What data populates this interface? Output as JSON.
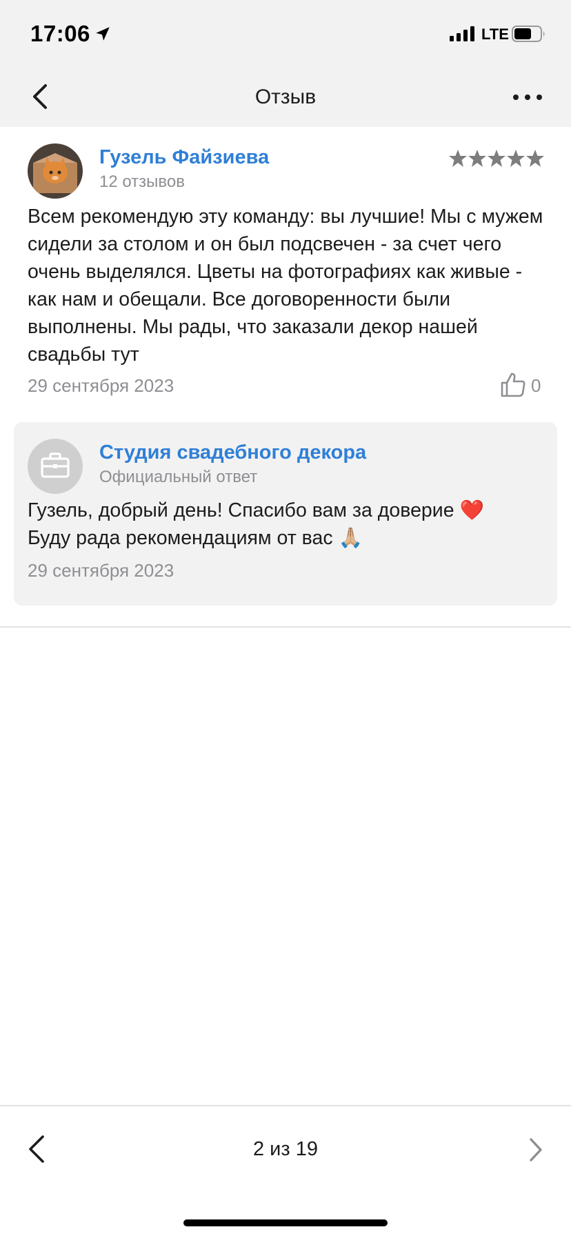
{
  "status_bar": {
    "time": "17:06",
    "network": "LTE",
    "icons": [
      "location-arrow-icon",
      "signal-icon",
      "battery-icon"
    ]
  },
  "nav": {
    "title": "Отзыв",
    "back_icon": "chevron-left-icon",
    "more_icon": "more-horizontal-icon"
  },
  "review": {
    "author": "Гузель Файзиева",
    "reviews_count": "12 отзывов",
    "rating": 5,
    "text": "Всем рекомендую эту команду: вы лучшие! Мы с мужем сидели за столом и он был подсвечен - за счет чего очень выделялся. Цветы на фотографиях как живые - как нам и обещали. Все договоренности были выполнены. Мы рады, что заказали декор нашей свадьбы тут",
    "date": "29 сентября 2023",
    "likes": "0"
  },
  "reply": {
    "author": "Студия свадебного декора",
    "label": "Официальный ответ",
    "line1": "Гузель, добрый день! Спасибо вам за доверие ❤️",
    "line2": "Буду рада рекомендациям от вас 🙏🏼",
    "date": "29 сентября 2023"
  },
  "pager": {
    "counter": "2 из 19"
  },
  "colors": {
    "accent": "#2f7fd6",
    "muted": "#8e8e93",
    "bar_bg": "#f2f2f2",
    "reply_bg": "#f2f2f2"
  }
}
